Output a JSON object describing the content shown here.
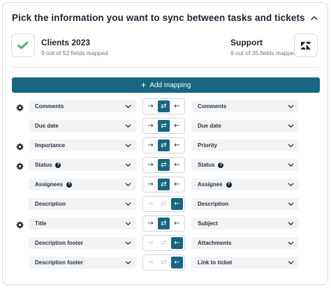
{
  "header": {
    "title": "Pick the information you want to sync between tasks and tickets"
  },
  "source_app": {
    "name": "Clients 2023",
    "fields_mapped": "9 out of 52 fields mapped"
  },
  "target_app": {
    "name": "Support",
    "fields_mapped": "9 out of 35 fields mapped"
  },
  "add_mapping": {
    "label": "Add mapping"
  },
  "colors": {
    "accent": "#16677f",
    "field_bg": "#f1f3f5",
    "disabled": "#c7ccd2"
  },
  "icons": {
    "arrow_right": "→",
    "arrow_both": "⇄",
    "arrow_left": "←"
  },
  "mappings": [
    {
      "left": "Comments",
      "right": "Comments",
      "gear": true,
      "left_info": false,
      "right_info": false,
      "direction": "both",
      "right_disabled": false
    },
    {
      "left": "Due date",
      "right": "Due date",
      "gear": false,
      "left_info": false,
      "right_info": false,
      "direction": "both",
      "right_disabled": false
    },
    {
      "left": "Importance",
      "right": "Priority",
      "gear": true,
      "left_info": false,
      "right_info": false,
      "direction": "both",
      "right_disabled": false
    },
    {
      "left": "Status",
      "right": "Status",
      "gear": true,
      "left_info": true,
      "right_info": true,
      "direction": "both",
      "right_disabled": false
    },
    {
      "left": "Assignees",
      "right": "Assignee",
      "gear": false,
      "left_info": true,
      "right_info": true,
      "direction": "both",
      "right_disabled": false
    },
    {
      "left": "Description",
      "right": "Description",
      "gear": false,
      "left_info": false,
      "right_info": false,
      "direction": "left",
      "right_disabled": true
    },
    {
      "left": "Title",
      "right": "Subject",
      "gear": true,
      "left_info": false,
      "right_info": false,
      "direction": "both",
      "right_disabled": false
    },
    {
      "left": "Description footer",
      "right": "Attachments",
      "gear": false,
      "left_info": false,
      "right_info": false,
      "direction": "left",
      "right_disabled": true
    },
    {
      "left": "Description footer",
      "right": "Link to ticket",
      "gear": false,
      "left_info": false,
      "right_info": false,
      "direction": "left",
      "right_disabled": true
    }
  ]
}
